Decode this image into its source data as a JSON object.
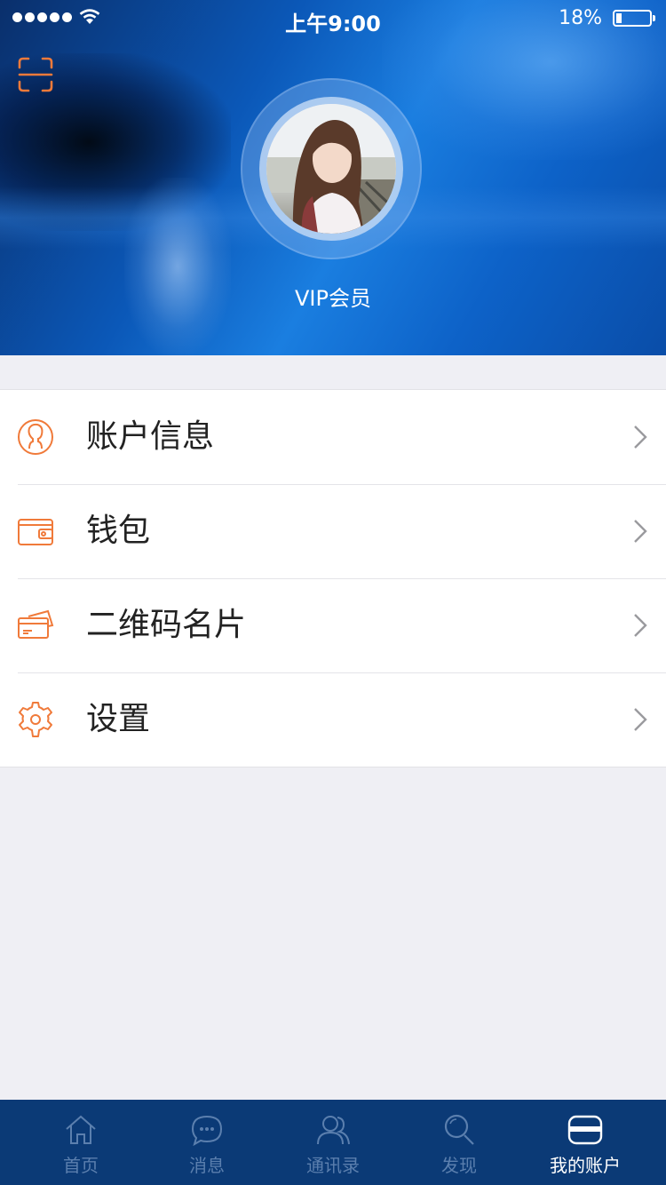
{
  "status_bar": {
    "time": "上午9:00",
    "battery": "18%"
  },
  "profile": {
    "member_level": "VIP会员"
  },
  "menu": [
    {
      "label": "账户信息",
      "icon": "user-circle-icon"
    },
    {
      "label": "钱包",
      "icon": "wallet-icon"
    },
    {
      "label": "二维码名片",
      "icon": "card-icon"
    },
    {
      "label": "设置",
      "icon": "gear-icon"
    }
  ],
  "tabbar": {
    "active_index": 4,
    "tabs": [
      {
        "label": "首页",
        "icon": "home-icon"
      },
      {
        "label": "消息",
        "icon": "message-icon"
      },
      {
        "label": "通讯录",
        "icon": "contacts-icon"
      },
      {
        "label": "发现",
        "icon": "search-icon"
      },
      {
        "label": "我的账户",
        "icon": "account-card-icon"
      }
    ]
  },
  "colors": {
    "accent": "#f07a3a",
    "tabbar_bg": "#0b3a76",
    "tab_inactive": "#5b7fae",
    "tab_active": "#ffffff",
    "page_bg": "#efeff4"
  }
}
